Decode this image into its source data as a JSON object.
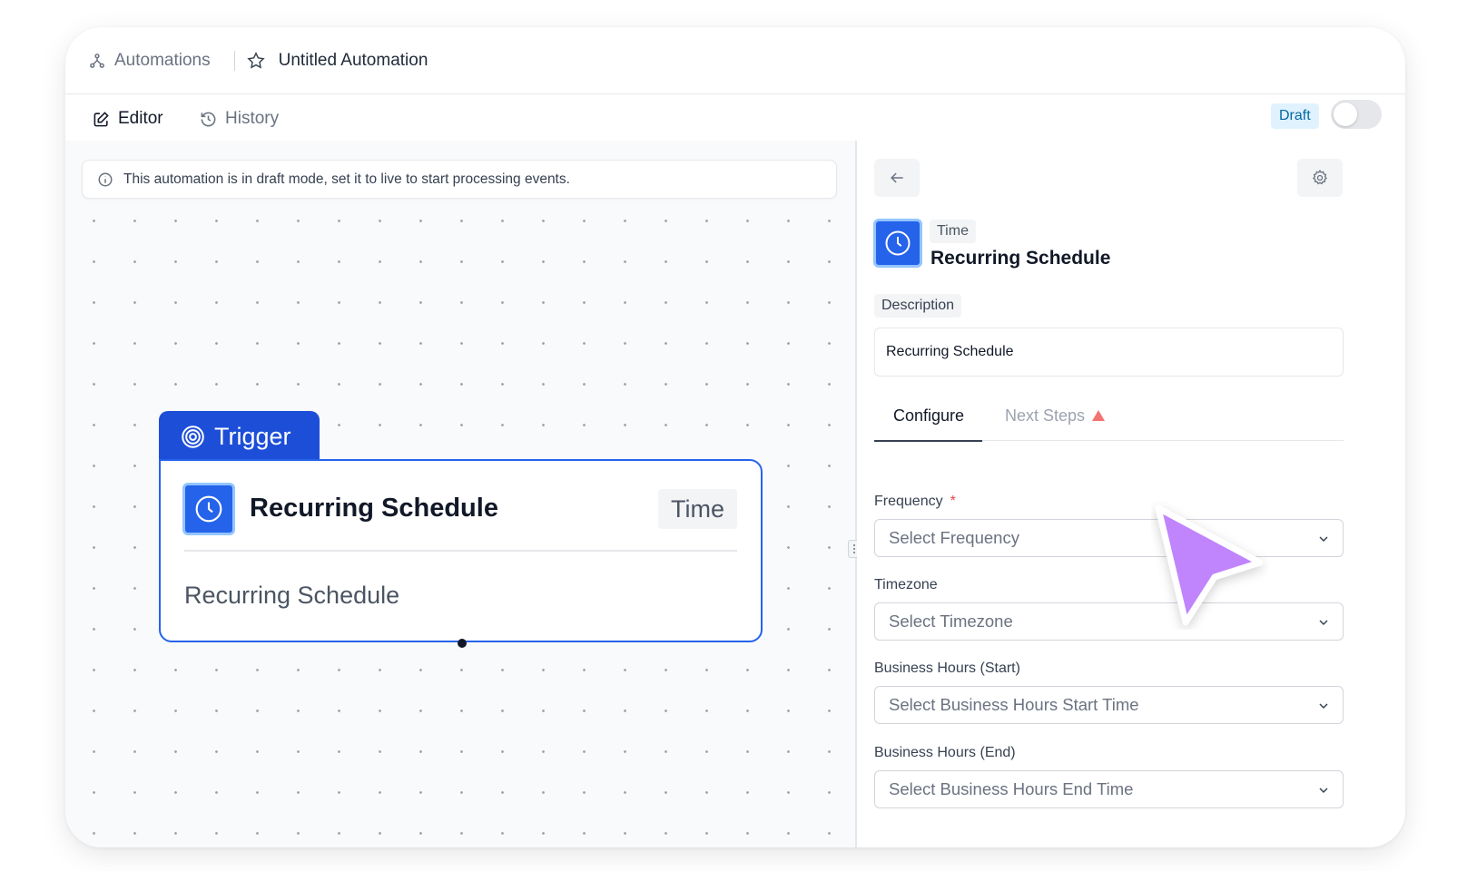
{
  "header": {
    "breadcrumb": "Automations",
    "title": "Untitled Automation"
  },
  "tabs": [
    {
      "label": "Editor"
    },
    {
      "label": "History"
    }
  ],
  "status": {
    "badge": "Draft",
    "live": false
  },
  "banner": {
    "text": "This automation is in draft mode, set it to live to start processing events."
  },
  "node": {
    "section": "Trigger",
    "title": "Recurring Schedule",
    "badge": "Time",
    "description": "Recurring Schedule"
  },
  "panel": {
    "tag": "Time",
    "title": "Recurring Schedule",
    "description_label": "Description",
    "description_value": "Recurring Schedule",
    "tabs": [
      {
        "label": "Configure"
      },
      {
        "label": "Next Steps"
      }
    ],
    "fields": [
      {
        "label": "Frequency",
        "required_mark": "*",
        "placeholder": "Select Frequency"
      },
      {
        "label": "Timezone",
        "placeholder": "Select Timezone"
      },
      {
        "label": "Business Hours (Start)",
        "placeholder": "Select Business Hours Start Time"
      },
      {
        "label": "Business Hours (End)",
        "placeholder": "Select Business Hours End Time"
      }
    ]
  },
  "colors": {
    "accent": "#2563eb",
    "trigger": "#1d4ed8",
    "cursor": "#c084fc",
    "draft_badge_bg": "#e0f2fe",
    "warning": "#ef4444"
  },
  "icons": [
    "automation-icon",
    "star-icon",
    "edit-icon",
    "history-icon",
    "info-icon",
    "target-icon",
    "clock-icon",
    "arrow-left-icon",
    "gear-icon",
    "chevron-down-icon",
    "warning-icon",
    "cursor-icon"
  ]
}
